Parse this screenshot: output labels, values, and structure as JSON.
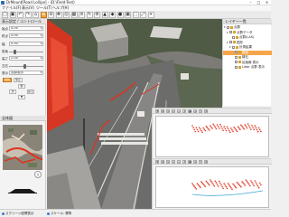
{
  "window": {
    "title": "DrMount[Road Lollipo] - (D:\\Field-Test)",
    "controls": [
      "–",
      "□",
      "✕"
    ]
  },
  "menu": {
    "items": [
      "ファイル(F)",
      "表示(V)",
      "ツール(T)",
      "ヘルプ(H)"
    ]
  },
  "toolbar": {
    "buttons": [
      "▢",
      "▣",
      "↶",
      "↷",
      "⌂",
      "⊕",
      "⊖",
      "✥",
      "◎",
      "▦",
      "≡",
      "✎",
      "⚙",
      "▲",
      "◆",
      "●",
      "▣",
      "⬚",
      "⤢",
      "⌖"
    ],
    "active_index": 5
  },
  "left_panel": {
    "header": "表示設定 / コントロール",
    "fields": [
      {
        "label": "始点",
        "value": "4.00"
      },
      {
        "label": "終点",
        "value": "5.00"
      },
      {
        "label": "幅",
        "value": "0.50"
      },
      {
        "label": "高さ",
        "value": "2.00"
      }
    ],
    "sliders": [
      {
        "label": "前後",
        "level": 0.15
      },
      {
        "label": "左右",
        "level": 0.45
      }
    ],
    "mode_label": "表示",
    "mode_value": "点群表示",
    "buttons": [
      "開始",
      "停止",
      "前",
      "次",
      "戻る"
    ]
  },
  "minimap": {
    "header": "全体図"
  },
  "right_panel": {
    "header": "レイヤー一覧",
    "tree": [
      {
        "label": "点群",
        "level": 0,
        "toggle": "▾",
        "selected": false
      },
      {
        "label": "点群データ",
        "level": 1,
        "toggle": "▾",
        "selected": false
      },
      {
        "label": "点群(LAS)",
        "level": 2,
        "toggle": "",
        "selected": false
      },
      {
        "label": "図形",
        "level": 1,
        "toggle": "▾",
        "selected": false
      },
      {
        "label": "計測結果",
        "level": 2,
        "toggle": "▾",
        "selected": false
      },
      {
        "label": "路面",
        "level": 3,
        "toggle": "",
        "selected": true
      },
      {
        "label": "縁石",
        "level": 3,
        "toggle": "",
        "selected": false
      },
      {
        "label": "区画線 表示",
        "level": 3,
        "toggle": "",
        "selected": false
      },
      {
        "label": "Lidar 点群 表示",
        "level": 3,
        "toggle": "",
        "selected": false
      }
    ]
  },
  "profile_panels": [
    {
      "name": "横断プロファイル"
    },
    {
      "name": "縦断プロファイル"
    }
  ],
  "statusbar": {
    "items": [
      "スクリーン座標表示",
      "スケール: 標準"
    ]
  },
  "colors": {
    "accent": "#f2a341",
    "points": "#e0321e",
    "selection": "#f6a64a"
  }
}
